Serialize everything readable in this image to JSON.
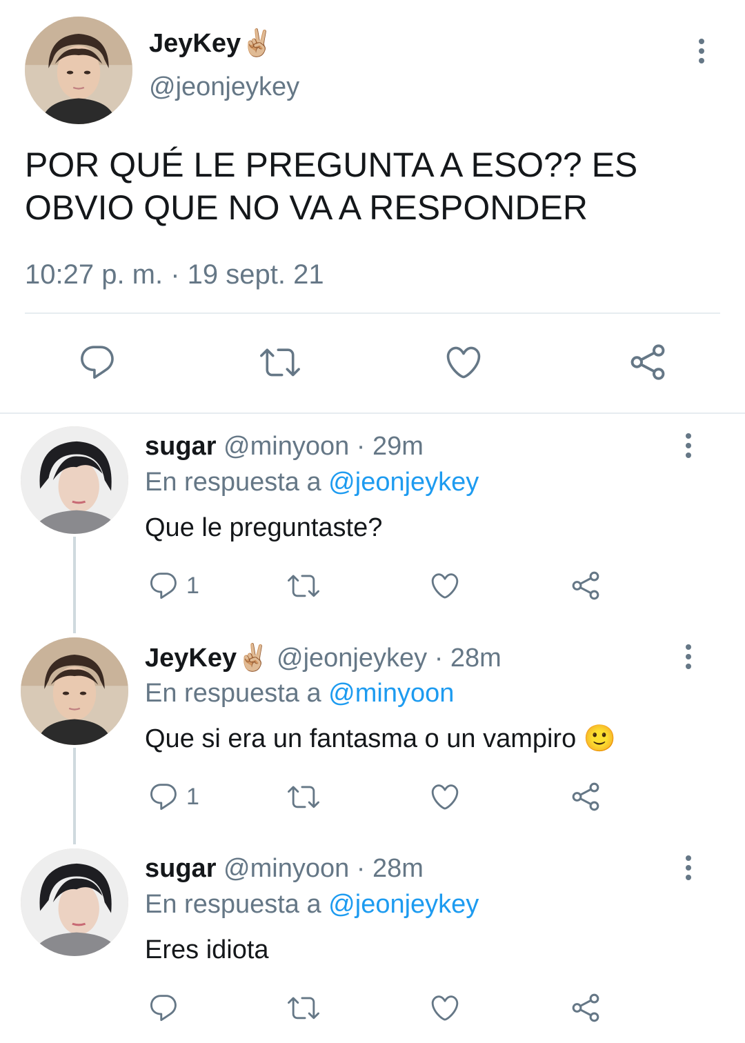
{
  "main_tweet": {
    "name": "JeyKey",
    "name_emoji": "✌🏼",
    "handle": "@jeonjeykey",
    "text_line1": "POR QUÉ LE PREGUNTA A ESO?? ES",
    "text_line2": "OBVIO QUE NO VA A RESPONDER",
    "timestamp": "10:27 p. m. · 19 sept. 21"
  },
  "replies": [
    {
      "name": "sugar",
      "handle_time": "@minyoon · 29m",
      "reply_to_label": "En respuesta a",
      "reply_to_handle": "@jeonjeykey",
      "text": "Que le preguntaste?",
      "reply_count": "1"
    },
    {
      "name": "JeyKey",
      "name_emoji": "✌🏼",
      "handle_time": "@jeonjeykey · 28m",
      "reply_to_label": "En respuesta a",
      "reply_to_handle": "@minyoon",
      "text": "Que si era un fantasma o un vampiro 🙂",
      "reply_count": "1"
    },
    {
      "name": "sugar",
      "handle_time": "@minyoon · 28m",
      "reply_to_label": "En respuesta a",
      "reply_to_handle": "@jeonjeykey",
      "text": "Eres idiota",
      "reply_count": ""
    }
  ],
  "colors": {
    "text": "#14171a",
    "muted": "#657786",
    "link": "#1d9bf0",
    "divider": "#e6ecf0"
  },
  "icons": [
    "more-vertical-icon",
    "reply-icon",
    "retweet-icon",
    "like-icon",
    "share-icon"
  ]
}
